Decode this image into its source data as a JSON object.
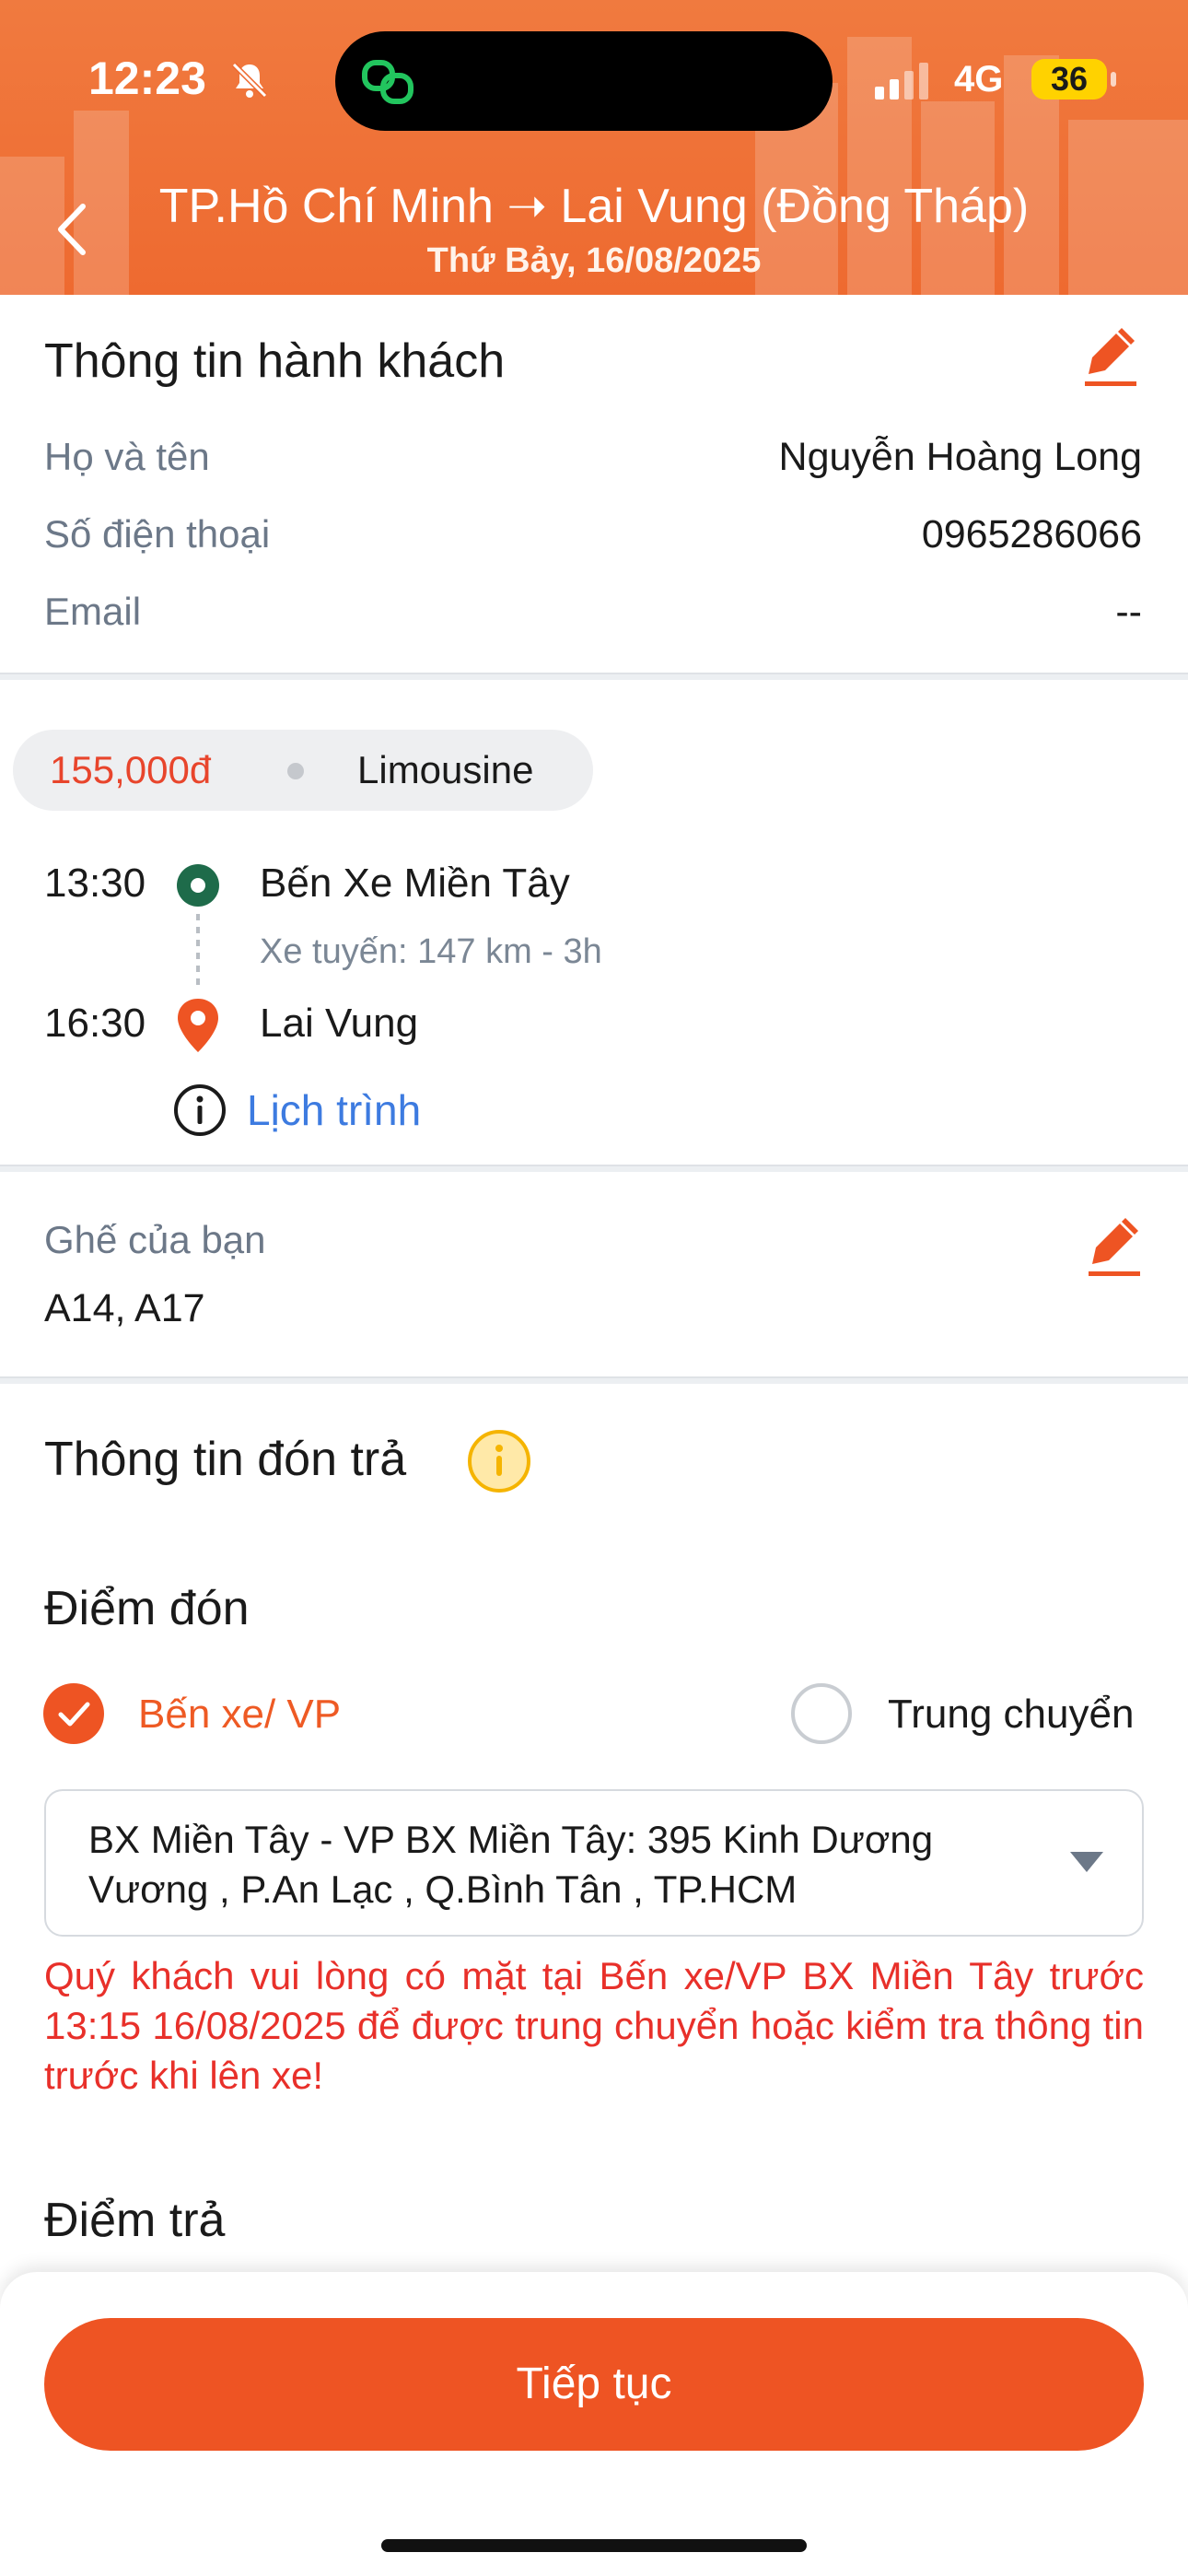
{
  "status_bar": {
    "time": "12:23",
    "network": "4G",
    "battery": "36"
  },
  "header": {
    "route": "TP.Hồ Chí Minh ➝ Lai Vung (Đồng Tháp)",
    "date": "Thứ Bảy, 16/08/2025"
  },
  "passenger": {
    "title": "Thông tin hành khách",
    "fields": [
      {
        "label": "Họ và tên",
        "value": "Nguyễn Hoàng Long"
      },
      {
        "label": "Số điện thoại",
        "value": "0965286066"
      },
      {
        "label": "Email",
        "value": "--"
      }
    ]
  },
  "trip": {
    "price": "155,000đ",
    "vehicle": "Limousine",
    "departure_time": "13:30",
    "origin": "Bến Xe Miền Tây",
    "meta": "Xe tuyến: 147 km - 3h",
    "arrival_time": "16:30",
    "destination": "Lai Vung",
    "schedule_link": "Lịch trình"
  },
  "seats": {
    "label": "Ghế của bạn",
    "value": "A14, A17"
  },
  "pickup_dropoff": {
    "title": "Thông tin đón trả",
    "pickup_title": "Điểm đón",
    "option_station": "Bến xe/ VP",
    "option_transfer": "Trung chuyển",
    "selected_location": "BX Miền Tây - VP BX Miền Tây: 395 Kinh Dương Vương , P.An Lạc , Q.Bình Tân , TP.HCM",
    "warning": "Quý khách vui lòng có mặt tại Bến xe/VP BX Miền Tây trước 13:15 16/08/2025 để được trung chuyển hoặc kiểm tra thông tin trước khi lên xe!",
    "dropoff_title": "Điểm trả"
  },
  "footer": {
    "continue_label": "Tiếp tục"
  },
  "colors": {
    "brand_orange": "#ee5423",
    "warning_red": "#e8302a",
    "link_blue": "#3d7be0",
    "origin_green": "#1e6b4a"
  }
}
